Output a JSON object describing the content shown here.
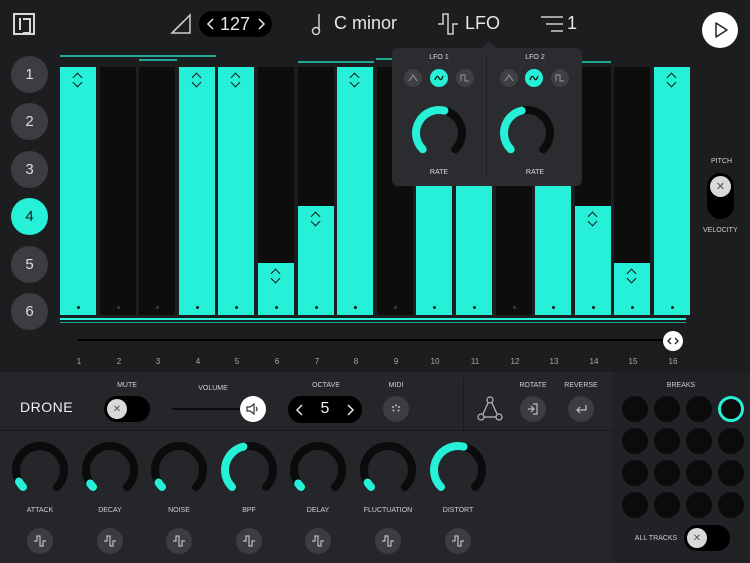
{
  "header": {
    "tempo": "127",
    "key": "C minor",
    "mod_label": "LFO",
    "pattern_count": "1"
  },
  "tracks": [
    "1",
    "2",
    "3",
    "4",
    "5",
    "6"
  ],
  "active_track": 3,
  "steps": {
    "numbers": [
      "1",
      "2",
      "3",
      "4",
      "5",
      "6",
      "7",
      "8",
      "9",
      "10",
      "11",
      "12",
      "13",
      "14",
      "15",
      "16"
    ],
    "levels": [
      1.0,
      0.0,
      0.0,
      1.0,
      1.0,
      0.21,
      0.44,
      1.0,
      0.0,
      1.0,
      1.0,
      0.0,
      1.0,
      0.44,
      0.21,
      1.0
    ]
  },
  "lfo_popup": {
    "lfo1": {
      "title": "LFO 1",
      "rate_label": "RATE",
      "rate": 0.55,
      "wave": 1
    },
    "lfo2": {
      "title": "LFO 2",
      "rate_label": "RATE",
      "rate": 0.45,
      "wave": 1
    }
  },
  "side": {
    "pitch_label": "PITCH",
    "velocity_label": "VELOCITY"
  },
  "bottom": {
    "track_name": "DRONE",
    "mute_label": "MUTE",
    "volume_label": "VOLUME",
    "volume": 0.88,
    "octave_label": "OCTAVE",
    "octave_value": "5",
    "midi_label": "MIDI",
    "rotate_label": "ROTATE",
    "reverse_label": "REVERSE",
    "breaks_label": "BREAKS",
    "all_tracks_label": "ALL TRACKS"
  },
  "knobs": [
    {
      "label": "ATTACK",
      "value": 0.06
    },
    {
      "label": "DECAY",
      "value": 0.04
    },
    {
      "label": "NOISE",
      "value": 0.05
    },
    {
      "label": "BPF",
      "value": 0.45
    },
    {
      "label": "DELAY",
      "value": 0.04
    },
    {
      "label": "FLUCTUATION",
      "value": 0.05
    },
    {
      "label": "DISTORT",
      "value": 0.55
    }
  ],
  "breaks": {
    "rows": 4,
    "cols": 4,
    "active_index": 3
  },
  "colors": {
    "accent": "#27f0d8",
    "background": "#1c1d1f",
    "panel": "#252629"
  }
}
